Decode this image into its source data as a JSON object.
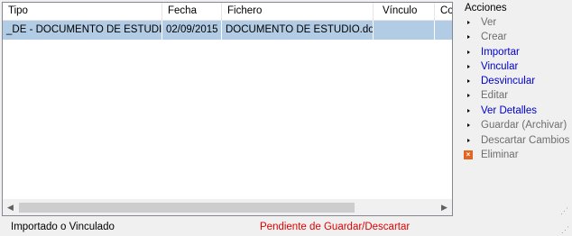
{
  "grid": {
    "columns": [
      "Tipo",
      "Fecha",
      "Fichero",
      "Vínculo",
      "Co"
    ],
    "rows": [
      {
        "tipo": "_DE - DOCUMENTO DE ESTUDIO",
        "fecha": "02/09/2015",
        "fichero": "DOCUMENTO DE ESTUDIO.doc",
        "vinculo": "",
        "co": ""
      }
    ]
  },
  "actions": {
    "title": "Acciones",
    "items": [
      {
        "label": "Ver",
        "state": "disabled"
      },
      {
        "label": "Crear",
        "state": "disabled"
      },
      {
        "label": "Importar",
        "state": "enabled"
      },
      {
        "label": "Vincular",
        "state": "enabled"
      },
      {
        "label": "Desvincular",
        "state": "enabled"
      },
      {
        "label": "Editar",
        "state": "disabled"
      },
      {
        "label": "Ver Detalles",
        "state": "enabled"
      },
      {
        "label": "Guardar (Archivar)",
        "state": "disabled"
      },
      {
        "label": "Descartar Cambios",
        "state": "disabled"
      },
      {
        "label": "Eliminar",
        "state": "disabled",
        "icon": "delete-x-icon"
      }
    ]
  },
  "status": {
    "left": "Importado o Vinculado",
    "right": "Pendiente de Guardar/Descartar",
    "right_color": "#e00000"
  }
}
